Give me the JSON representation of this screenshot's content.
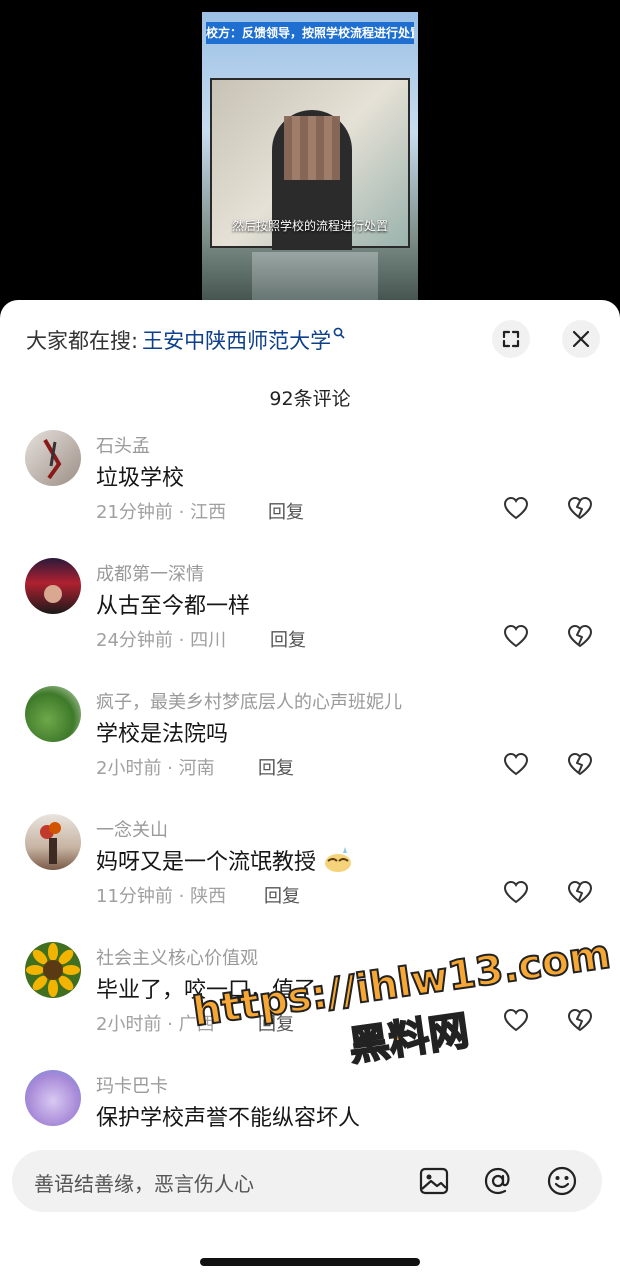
{
  "video": {
    "banner": "校方：反馈领导，按照学校流程进行处置",
    "subtitle": "然后按照学校的流程进行处置"
  },
  "header": {
    "search_prefix": "大家都在搜:",
    "search_term": "王安中陕西师范大学",
    "search_icon": "search-icon",
    "expand_icon": "expand-icon",
    "close_icon": "close-icon"
  },
  "comments_count": "92条评论",
  "comments": [
    {
      "name": "石头孟",
      "text": "垃圾学校",
      "meta": "21分钟前 · 江西",
      "reply": "回复",
      "avatar_color": "#b8b0a8"
    },
    {
      "name": "成都第一深情",
      "text": "从古至今都一样",
      "meta": "24分钟前 · 四川",
      "reply": "回复",
      "avatar_color": "#3b2a3a"
    },
    {
      "name": "疯子，最美乡村梦底层人的心声班妮儿",
      "text": "学校是法院吗",
      "meta": "2小时前 · 河南",
      "reply": "回复",
      "avatar_color": "#5f8f3a"
    },
    {
      "name": "一念关山",
      "text": "妈呀又是一个流氓教授",
      "meta": "11分钟前 · 陕西",
      "reply": "回复",
      "avatar_color": "#a08a7a"
    },
    {
      "name": "社会主义核心价值观",
      "text": "毕业了，咬一口，值了",
      "meta": "2小时前 · 广西",
      "reply": "回复",
      "avatar_color": "#e8b21a"
    },
    {
      "name": "玛卡巴卡",
      "text": "保护学校声誉不能纵容坏人",
      "avatar_color": "#c9b7e6"
    }
  ],
  "input": {
    "placeholder": "善语结善缘，恶言伤人心",
    "image_icon": "image-icon",
    "at_icon": "at-icon",
    "emoji_icon": "emoji-icon"
  },
  "watermark": {
    "line1": "https://ihlw13.com",
    "line2": "黑料网"
  }
}
